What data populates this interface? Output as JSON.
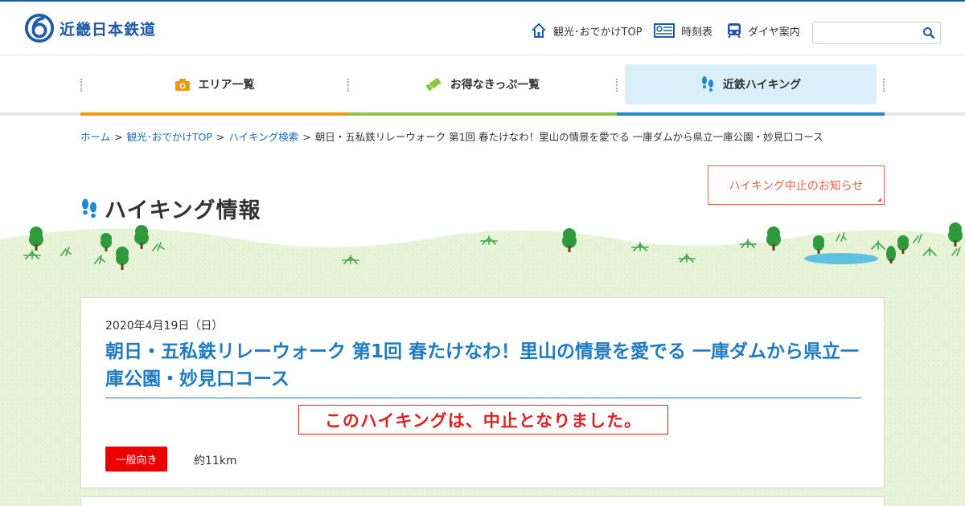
{
  "header": {
    "logo_text": "近畿日本鉄道",
    "links": [
      {
        "label": "観光･おでかけTOP",
        "icon": "home-icon"
      },
      {
        "label": "時刻表",
        "icon": "timetable-icon"
      },
      {
        "label": "ダイヤ案内",
        "icon": "train-icon"
      }
    ],
    "search": {
      "value": "",
      "placeholder": ""
    }
  },
  "nav": {
    "items": [
      {
        "label": "エリア一覧",
        "icon": "camera-icon",
        "color": "#f39800"
      },
      {
        "label": "お得なきっぷ一覧",
        "icon": "ticket-icon",
        "color": "#8cc63f"
      },
      {
        "label": "近鉄ハイキング",
        "icon": "footprints-icon",
        "color": "#1e88d0"
      }
    ]
  },
  "breadcrumb": {
    "items": [
      "ホーム",
      "観光･おでかけTOP",
      "ハイキング検索"
    ],
    "current": "朝日・五私鉄リレーウォーク 第1回 春たけなわ！里山の情景を愛でる 一庫ダムから県立一庫公園・妙見口コース",
    "separator": ">"
  },
  "notice_button": "ハイキング中止のお知らせ",
  "page_title": "ハイキング情報",
  "event": {
    "date": "2020年4月19日（日）",
    "title": "朝日・五私鉄リレーウォーク 第1回 春たけなわ！里山の情景を愛でる 一庫ダムから県立一庫公園・妙見口コース",
    "cancel_notice": "このハイキングは、中止となりました。",
    "level": "一般向き",
    "distance": "約11km"
  },
  "colors": {
    "brand": "#1e5aa8",
    "link": "#1e6bb8",
    "title_blue": "#1e7bc4",
    "alert_red": "#e02020",
    "ground_green": "#e6f3d4"
  }
}
